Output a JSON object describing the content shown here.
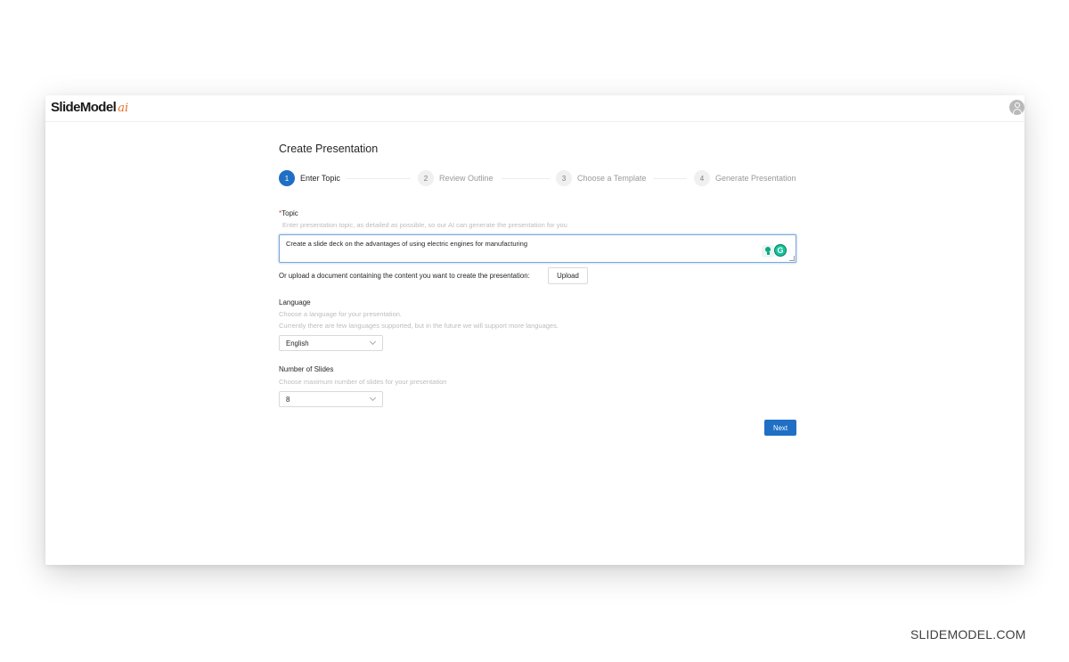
{
  "header": {
    "logo_text": "SlideModel",
    "logo_suffix": "ai",
    "avatar_icon": "user-icon"
  },
  "page": {
    "title": "Create Presentation"
  },
  "steps": [
    {
      "number": "1",
      "label": "Enter Topic",
      "state": "active"
    },
    {
      "number": "2",
      "label": "Review Outline",
      "state": "inactive"
    },
    {
      "number": "3",
      "label": "Choose a Template",
      "state": "inactive"
    },
    {
      "number": "4",
      "label": "Generate Presentation",
      "state": "inactive"
    }
  ],
  "topic": {
    "required_mark": "*",
    "label": "Topic",
    "placeholder_hint": "Enter presentation topic, as detailed as possible, so our AI can generate the presentation for you",
    "value": "Create a slide deck on the advantages of using electric engines for manufacturing"
  },
  "upload": {
    "text": "Or upload a document containing the content you want to create the presentation:",
    "button_label": "Upload"
  },
  "language": {
    "label": "Language",
    "help_1": "Choose a language for your presentation.",
    "help_2": "Currently there are few languages supported, but in the future we will support more languages.",
    "selected": "English"
  },
  "slides": {
    "label": "Number of Slides",
    "help": "Choose maximum number of slides for your presentation",
    "selected": "8"
  },
  "actions": {
    "next_label": "Next"
  },
  "colors": {
    "accent": "#1f6fc5",
    "logo_ai": "#e8702a",
    "grammarly": "#15c39a"
  },
  "watermark": "SLIDEMODEL.COM"
}
